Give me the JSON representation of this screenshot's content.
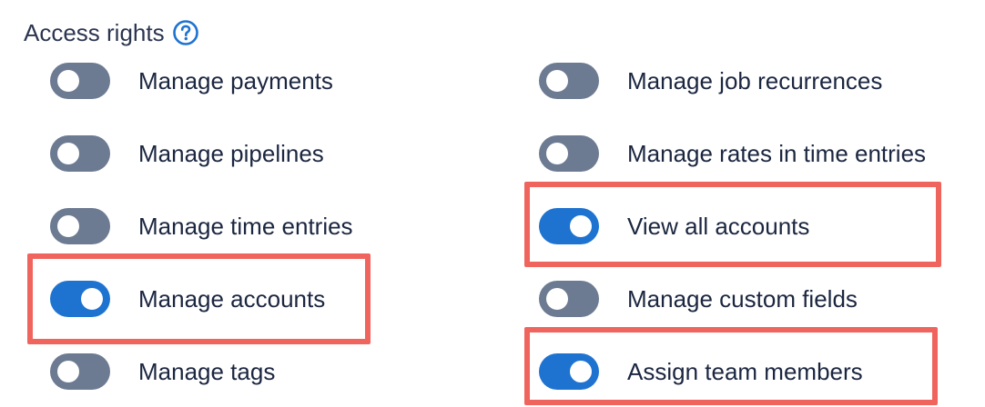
{
  "section": {
    "title": "Access rights",
    "help_icon": "question-circle-icon",
    "accent_color": "#1f73d0"
  },
  "colors": {
    "toggle_off": "#6c7a92",
    "toggle_on": "#1f73d0",
    "highlight": "#f0645e"
  },
  "toggles": {
    "manage_payments": {
      "label": "Manage payments",
      "enabled": false
    },
    "manage_pipelines": {
      "label": "Manage pipelines",
      "enabled": false
    },
    "manage_time_entries": {
      "label": "Manage time entries",
      "enabled": false
    },
    "manage_accounts": {
      "label": "Manage accounts",
      "enabled": true,
      "highlighted": true
    },
    "manage_tags": {
      "label": "Manage tags",
      "enabled": false
    },
    "manage_job_recurrences": {
      "label": "Manage job recurrences",
      "enabled": false
    },
    "manage_rates_in_time_entries": {
      "label": "Manage rates in time entries",
      "enabled": false
    },
    "view_all_accounts": {
      "label": "View all accounts",
      "enabled": true,
      "highlighted": true
    },
    "manage_custom_fields": {
      "label": "Manage custom fields",
      "enabled": false
    },
    "assign_team_members": {
      "label": "Assign team members",
      "enabled": true,
      "highlighted": true
    }
  }
}
